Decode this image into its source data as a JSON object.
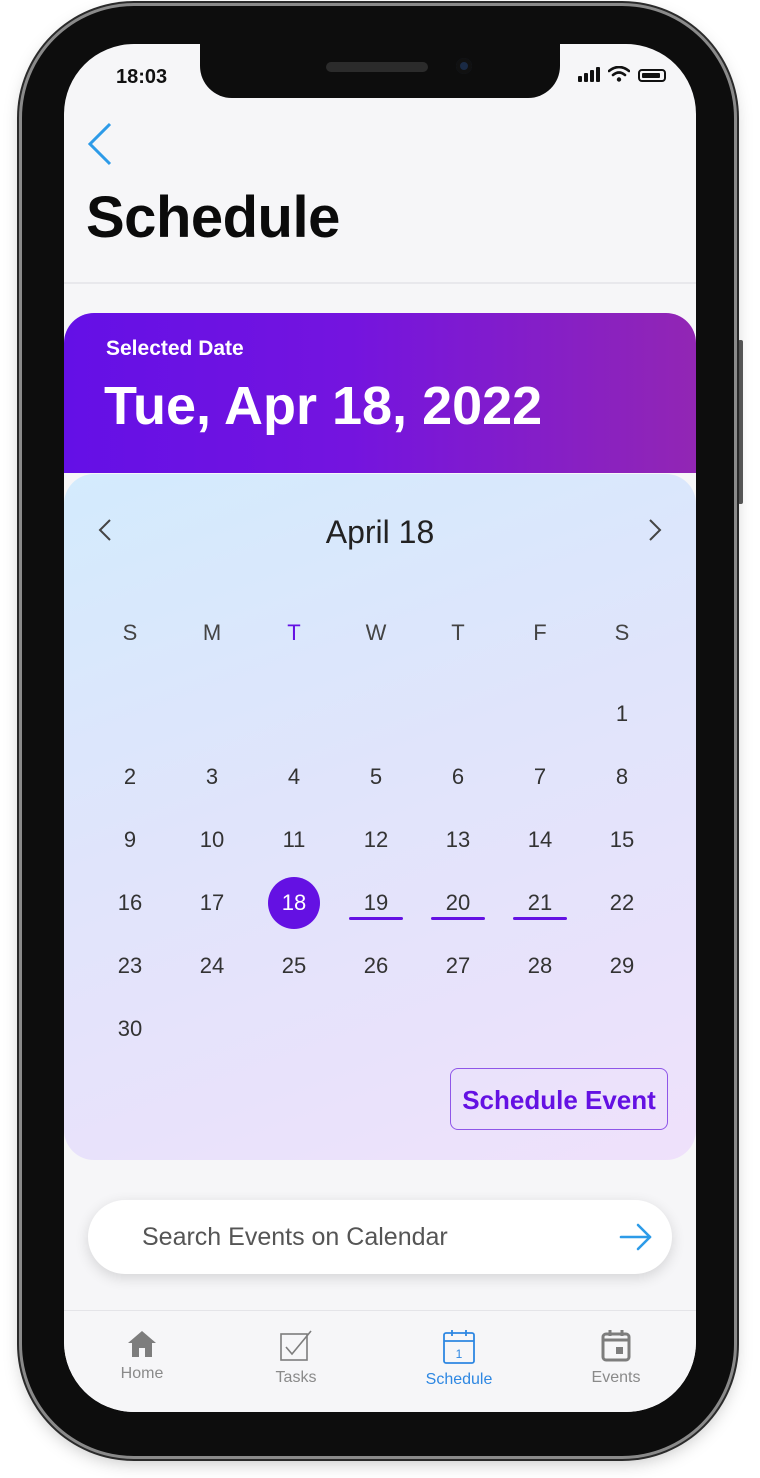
{
  "status_bar": {
    "time": "18:03"
  },
  "header": {
    "title": "Schedule"
  },
  "selected_date": {
    "caption": "Selected Date",
    "value": "Tue, Apr 18, 2022"
  },
  "calendar": {
    "month_label": "April 18",
    "weekdays": [
      "S",
      "M",
      "T",
      "W",
      "T",
      "F",
      "S"
    ],
    "highlighted_weekday_index": 2,
    "weeks": [
      [
        "",
        "",
        "",
        "",
        "",
        "",
        "1"
      ],
      [
        "2",
        "3",
        "4",
        "5",
        "6",
        "7",
        "8"
      ],
      [
        "9",
        "10",
        "11",
        "12",
        "13",
        "14",
        "15"
      ],
      [
        "16",
        "17",
        "18",
        "19",
        "20",
        "21",
        "22"
      ],
      [
        "23",
        "24",
        "25",
        "26",
        "27",
        "28",
        "29"
      ],
      [
        "30",
        "",
        "",
        "",
        "",
        "",
        ""
      ]
    ],
    "selected_day": "18",
    "days_with_events": [
      "19",
      "20",
      "21"
    ]
  },
  "actions": {
    "schedule_event_label": "Schedule Event"
  },
  "search": {
    "placeholder": "Search Events on Calendar"
  },
  "tabbar": {
    "items": [
      {
        "label": "Home",
        "icon": "home-icon"
      },
      {
        "label": "Tasks",
        "icon": "tasks-checkbox-icon"
      },
      {
        "label": "Schedule",
        "icon": "calendar-day-icon"
      },
      {
        "label": "Events",
        "icon": "calendar-event-icon"
      }
    ],
    "active_index": 2
  },
  "colors": {
    "accent_purple": "#6411e3",
    "link_blue": "#2d87e2",
    "date_card_gradient": [
      "#6410e6",
      "#9226b4"
    ],
    "calendar_gradient": [
      "#d3ebfd",
      "#efe1fb"
    ]
  }
}
